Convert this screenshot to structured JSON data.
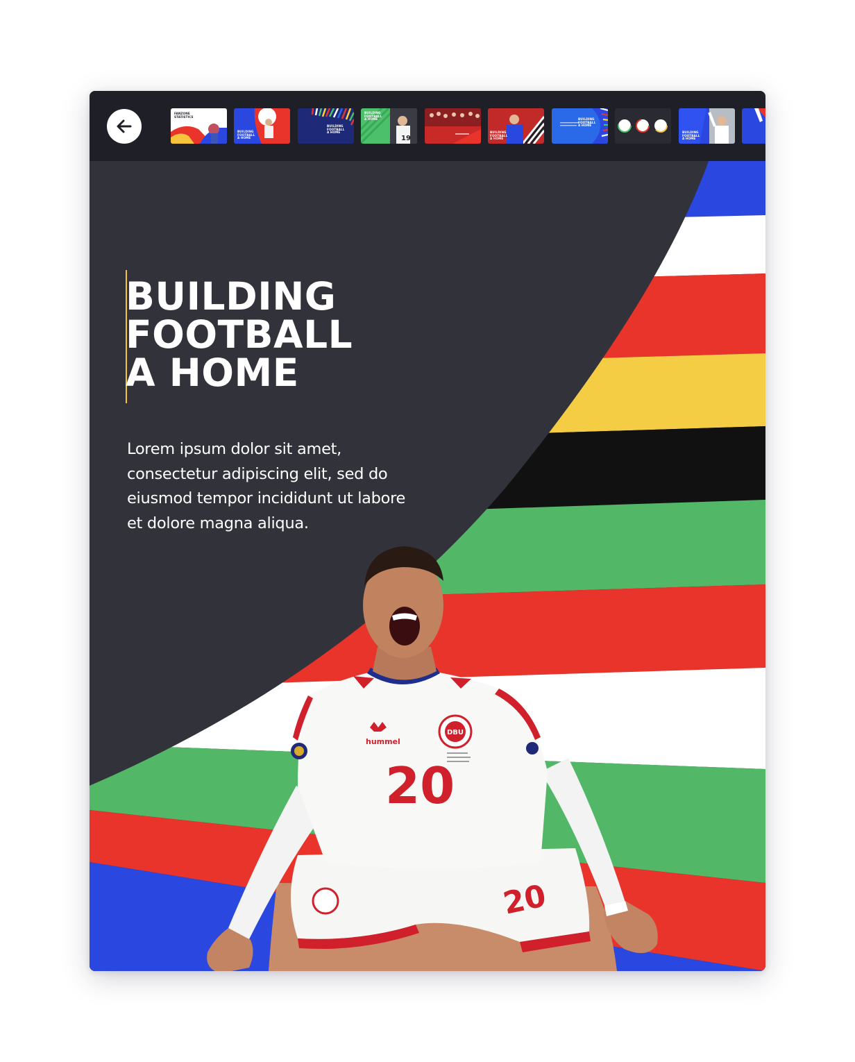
{
  "nav": {
    "back_icon": "arrow-left-icon"
  },
  "thumbnails": [
    {
      "label": "FANZONE\nSTATISTICS",
      "colors": [
        "#ffffff",
        "#e8342a",
        "#f5c43c",
        "#2a48e0"
      ]
    },
    {
      "label": "BUILDING\nFOOTBALL\nA HOME",
      "colors": [
        "#2a48e0",
        "#e8342a",
        "#ffffff"
      ]
    },
    {
      "label": "BUILDING\nFOOTBALL\nA HOME",
      "colors": [
        "#1e2a78",
        "#ffd22e",
        "#e8342a",
        "#4cc06a"
      ]
    },
    {
      "label": "BUILDING\nFOOTBALL\nA HOME",
      "colors": [
        "#4cc06a",
        "#2f2f38",
        "#ffffff"
      ]
    },
    {
      "label": "",
      "colors": [
        "#e8342a",
        "#7a1d1d",
        "#ffffff"
      ]
    },
    {
      "label": "BUILDING\nFOOTBALL\nA HOME",
      "colors": [
        "#e8342a",
        "#2a48e0",
        "#ffffff"
      ]
    },
    {
      "label": "BUILDING\nFOOTBALL\nA HOME",
      "colors": [
        "#2a6ae8",
        "#ffffff",
        "#e8342a"
      ]
    },
    {
      "label": "",
      "colors": [
        "#2a2a33",
        "#ffffff",
        "#4cc06a",
        "#e8342a"
      ]
    },
    {
      "label": "BUILDING\nFOOTBALL\nA HOME",
      "colors": [
        "#2a48e0",
        "#ffffff",
        "#c9c9c9"
      ]
    },
    {
      "label": "",
      "colors": [
        "#2a48e0",
        "#ffffff",
        "#e8342a"
      ]
    }
  ],
  "hero": {
    "title_line1": "BUILDING",
    "title_line2": "FOOTBALL",
    "title_line3": "A HOME",
    "body": "Lorem ipsum dolor sit amet, consectetur adipiscing elit, sed do eiusmod tempor incididunt ut labore et dolore magna aliqua."
  },
  "player": {
    "shirt_number": "20",
    "shorts_number": "20",
    "brand": "hummel",
    "crest": "DBU"
  },
  "stripes": [
    "#2a48e0",
    "#ffffff",
    "#e8342a",
    "#f5cd45",
    "#111111",
    "#52b868",
    "#e8342a",
    "#ffffff",
    "#52b868",
    "#e8342a",
    "#2a48e0"
  ],
  "colors": {
    "panel": "#32323b",
    "topbar": "#1f1f28",
    "accent": "#f5c43c"
  }
}
